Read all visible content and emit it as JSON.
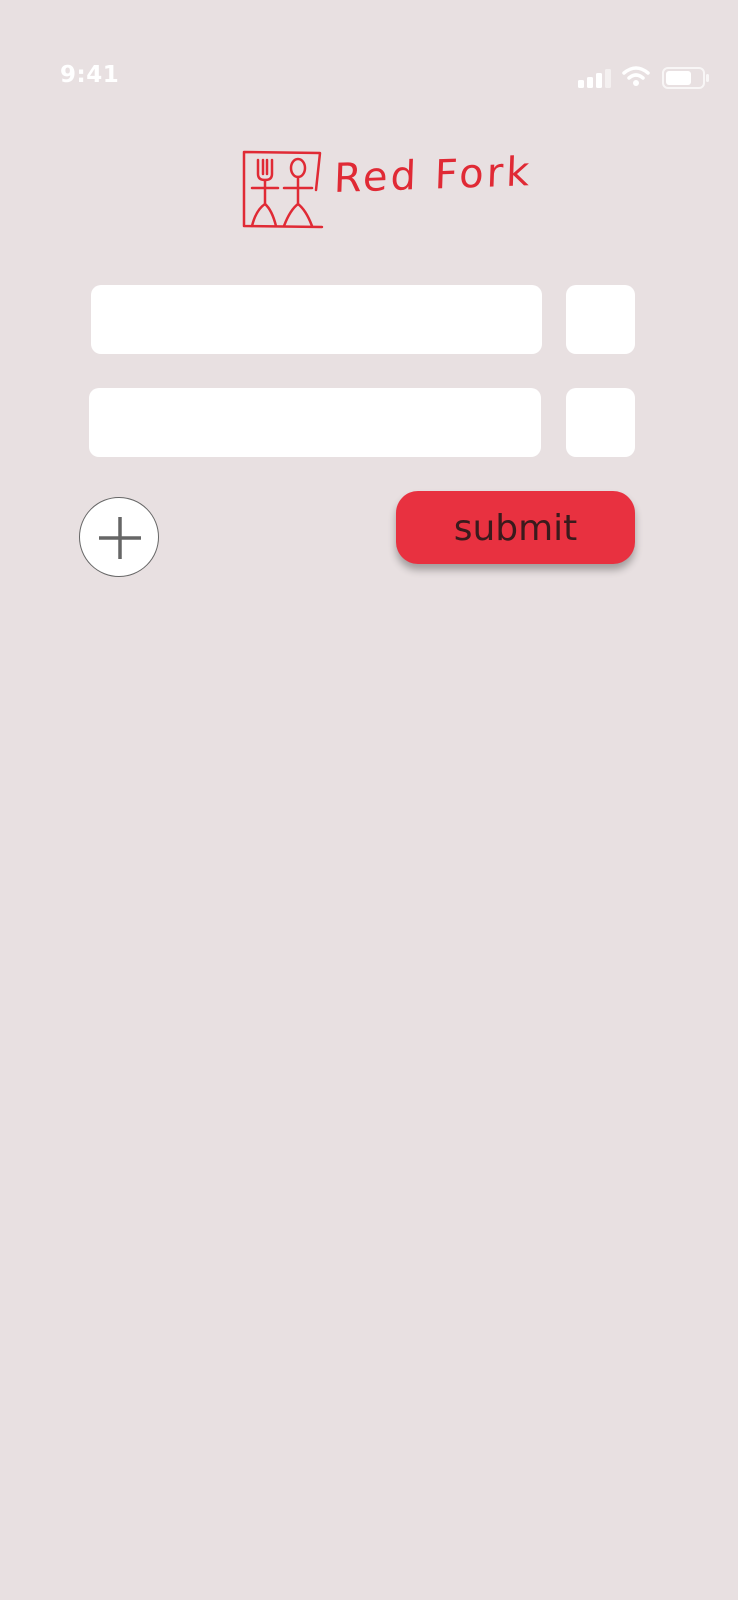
{
  "status_bar": {
    "time": "9:41",
    "icons": [
      "signal-icon",
      "wifi-icon",
      "battery-icon"
    ]
  },
  "brand": {
    "name": "Red Fork",
    "logo_icon": "fork-and-person-logo",
    "color": "#e02a35"
  },
  "form": {
    "rows": [
      {
        "item_value": "",
        "quantity_value": ""
      },
      {
        "item_value": "",
        "quantity_value": ""
      }
    ],
    "add_icon": "plus-icon",
    "submit_label": "submit"
  },
  "colors": {
    "background": "#e8e0e1",
    "accent": "#e83140",
    "field": "#ffffff"
  }
}
